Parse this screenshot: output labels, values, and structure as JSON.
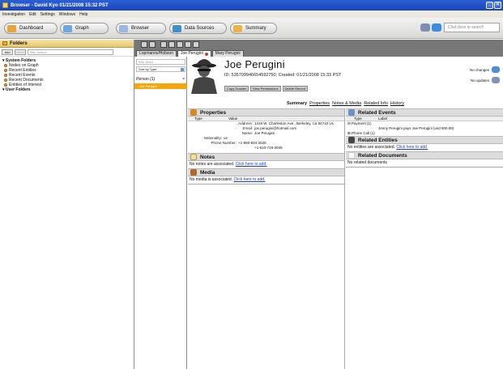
{
  "window": {
    "title": "Browser - David Kyo 01/21/2008 15:32 PST"
  },
  "menu": [
    "Investigation",
    "Edit",
    "Settings",
    "Windows",
    "Help"
  ],
  "toolbar": {
    "dashboard": "Dashboard",
    "graph": "Graph",
    "browser": "Browser",
    "data_sources": "Data Sources",
    "summary": "Summary",
    "search_placeholder": "Click here to search"
  },
  "folders": {
    "title": "Folders",
    "btn_add": "Add",
    "btn_del": "Delete",
    "filter_placeholder": "filter folders",
    "system_label": "System Folders",
    "system_items": [
      "Nodes on Graph",
      "Recent Entities",
      "Recent Events",
      "Recent Documents",
      "Entities of Interest"
    ],
    "user_label": "User Folders"
  },
  "tabs": [
    {
      "label": "Lopmanov/Hobson"
    },
    {
      "label": "Joe Perugini"
    },
    {
      "label": "Mary Perugini"
    }
  ],
  "entitylist": {
    "filter_placeholder": "filter items",
    "sort_label": "Sort by Type",
    "group_label": "Person (1)",
    "group_close": "×",
    "selected_item": "Joe Perugini"
  },
  "person": {
    "name": "Joe Perugini",
    "id_line": "ID: 535709946654592750; Created: 01/21/2008 15:33 PST",
    "buttons": [
      "Copy Dossier",
      "View Permissions",
      "Delete Record"
    ],
    "no_changes": "No changes",
    "no_updates": "No updates"
  },
  "subtabs": [
    "Summary",
    "Properties",
    "Notes & Media",
    "Related Info",
    "History"
  ],
  "properties": {
    "title": "Properties",
    "col_type": "Type",
    "col_value": "Value",
    "rows": [
      {
        "k": "Address:",
        "v": "1419 W. Charleston Ave., Berkeley, Ca 94710 Us"
      },
      {
        "k": "Email:",
        "v": "joe.perugini@hotmail.com"
      },
      {
        "k": "Name:",
        "v": "Joe Perugini"
      },
      {
        "k": "Nationality:",
        "v": "us"
      },
      {
        "k": "Phone Number:",
        "v": "+1-660-834-2628"
      },
      {
        "k": "",
        "v": "+1-610-719-2045"
      }
    ]
  },
  "notes": {
    "title": "Notes",
    "msg": "No notes are associated.",
    "link": "Click here to add."
  },
  "media": {
    "title": "Media",
    "msg": "No media is associated.",
    "link": "Click here to add."
  },
  "events": {
    "title": "Related Events",
    "col_type": "Type",
    "col_label": "Label",
    "payment": "Payment (1)",
    "payment_row": "Jenny Perugini pays Joe Perugini (usd 800.00)",
    "phonecall": "Phone Call (1)"
  },
  "entities": {
    "title": "Related Entities",
    "msg": "No entities are associated.",
    "link": "Click here to add."
  },
  "documents": {
    "title": "Related Documents",
    "msg": "No related documents"
  }
}
